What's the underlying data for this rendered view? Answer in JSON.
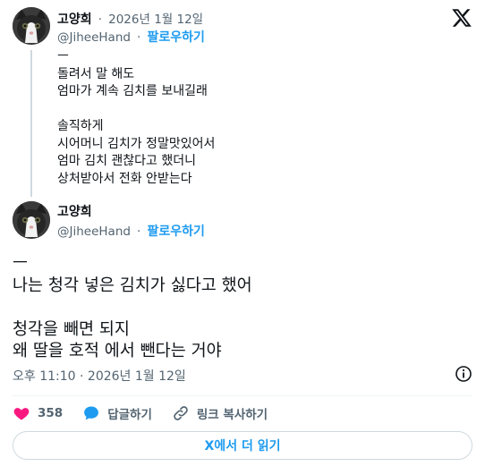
{
  "reply_tweet": {
    "display_name": "고양희",
    "separator": "·",
    "date": "2026년 1월 12일",
    "handle": "@JiheeHand",
    "follow_label": "팔로우하기",
    "body": "ㅡ\n돌려서 말 해도\n엄마가 계속 김치를 보내길래\n\n솔직하게\n시어머니 김치가 정말맛있어서\n엄마 김치 괜찮다고 했더니\n상처받아서 전화 안받는다"
  },
  "main_tweet": {
    "display_name": "고양희",
    "handle": "@JiheeHand",
    "separator": "·",
    "follow_label": "팔로우하기",
    "body": "ㅡ\n나는 청각 넣은 김치가 싫다고 했어\n\n청각을 빼면 되지\n왜 딸을 호적 에서 뺀다는 거야",
    "timestamp": "오후 11:10 · 2026년 1월 12일"
  },
  "actions": {
    "like_count": "358",
    "reply_label": "답글하기",
    "copy_link_label": "링크 복사하기"
  },
  "read_more_label": "X에서 더 읽기",
  "icons": {
    "brand": "x-logo-icon",
    "info": "info-icon",
    "like": "heart-icon",
    "reply": "speech-bubble-icon",
    "link": "link-icon"
  },
  "colors": {
    "accent": "#1d9bf0",
    "like": "#f91880",
    "text": "#0f1419",
    "muted": "#536471"
  }
}
